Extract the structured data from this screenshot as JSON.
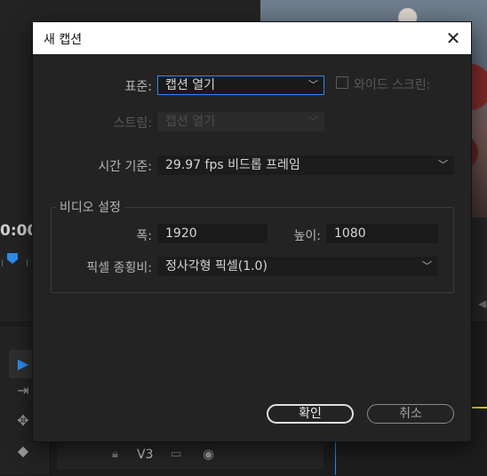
{
  "background": {
    "timecode": "0:00:",
    "track_name": "V3"
  },
  "dialog": {
    "title": "새 캡션",
    "close_symbol": "✕",
    "standard_label": "표준:",
    "standard_value": "캡션 열기",
    "widescreen_label": "와이드 스크린:",
    "stream_label": "스트림:",
    "stream_value": "캡션 열기",
    "timebase_label": "시간 기준:",
    "timebase_value": "29.97 fps 비드롭 프레임",
    "video_group_label": "비디오 설정",
    "width_label": "폭:",
    "width_value": "1920",
    "height_label": "높이:",
    "height_value": "1080",
    "pixel_aspect_label": "픽셀 종횡비:",
    "pixel_aspect_value": "정사각형 픽셀(1.0)",
    "ok_label": "확인",
    "cancel_label": "취소"
  },
  "icons": {
    "chevron": "chevron-down-icon",
    "checkbox": "checkbox-unchecked-icon"
  },
  "colors": {
    "accent": "#2d8ceb",
    "dialog_bg": "#232323",
    "titlebar_bg": "#ffffff"
  }
}
